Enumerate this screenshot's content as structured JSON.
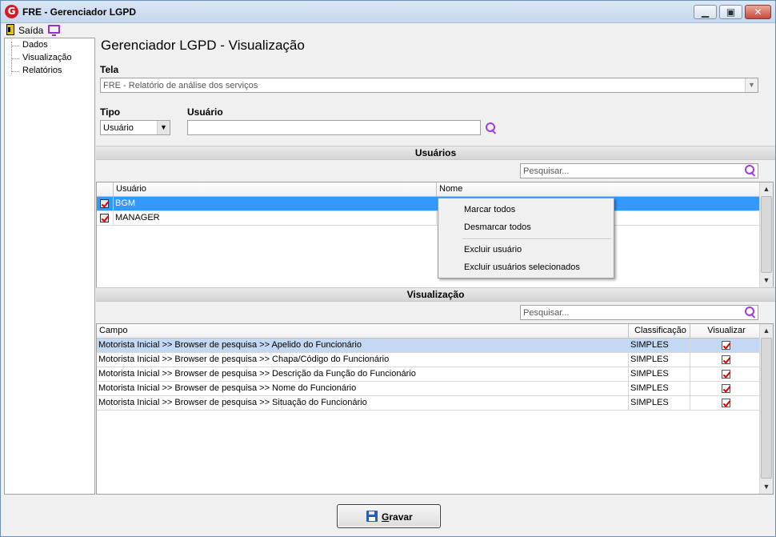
{
  "window": {
    "title": "FRE - Gerenciador LGPD",
    "logo_letter": "G",
    "min_glyph": "▁",
    "max_glyph": "▣",
    "close_glyph": "✕"
  },
  "menubar": {
    "exit_label": "Saída"
  },
  "tree": {
    "items": [
      "Dados",
      "Visualização",
      "Relatórios"
    ]
  },
  "page": {
    "title": "Gerenciador LGPD - Visualização"
  },
  "tela": {
    "label": "Tela",
    "value": "FRE - Relatório de análise dos serviços",
    "arrow": "▼"
  },
  "tipo": {
    "label": "Tipo",
    "value": "Usuário",
    "arrow": "▼"
  },
  "usuario_filter": {
    "label": "Usuário",
    "value": ""
  },
  "usuarios_section": {
    "title": "Usuários",
    "search_placeholder": "Pesquisar...",
    "columns": [
      "Usuário",
      "Nome"
    ],
    "rows": [
      {
        "checked": true,
        "usuario": "BGM",
        "nome": "",
        "selected": true
      },
      {
        "checked": true,
        "usuario": "MANAGER",
        "nome": "",
        "selected": false
      }
    ]
  },
  "context_menu": {
    "items": [
      "Marcar todos",
      "Desmarcar todos",
      "Excluir usuário",
      "Excluir usuários selecionados"
    ]
  },
  "visualizacao_section": {
    "title": "Visualização",
    "search_placeholder": "Pesquisar...",
    "columns": [
      "Campo",
      "Classificação",
      "Visualizar"
    ],
    "rows": [
      {
        "campo": "Motorista Inicial >> Browser de pesquisa >> Apelido do Funcionário",
        "classificacao": "SIMPLES",
        "visualizar": true,
        "selected": true
      },
      {
        "campo": "Motorista Inicial >> Browser de pesquisa >> Chapa/Código do Funcionário",
        "classificacao": "SIMPLES",
        "visualizar": true,
        "selected": false
      },
      {
        "campo": "Motorista Inicial >> Browser de pesquisa >> Descrição da Função do Funcionário",
        "classificacao": "SIMPLES",
        "visualizar": true,
        "selected": false
      },
      {
        "campo": "Motorista Inicial >> Browser de pesquisa >> Nome do Funcionário",
        "classificacao": "SIMPLES",
        "visualizar": true,
        "selected": false
      },
      {
        "campo": "Motorista Inicial >> Browser de pesquisa >> Situação do Funcionário",
        "classificacao": "SIMPLES",
        "visualizar": true,
        "selected": false
      }
    ]
  },
  "footer": {
    "save_label_first": "G",
    "save_label_rest": "ravar"
  },
  "scroll": {
    "up": "▲",
    "down": "▼"
  },
  "colors": {
    "selection": "#3399ff",
    "selection_light": "#c2d8f3",
    "accent": "#a23be0"
  }
}
